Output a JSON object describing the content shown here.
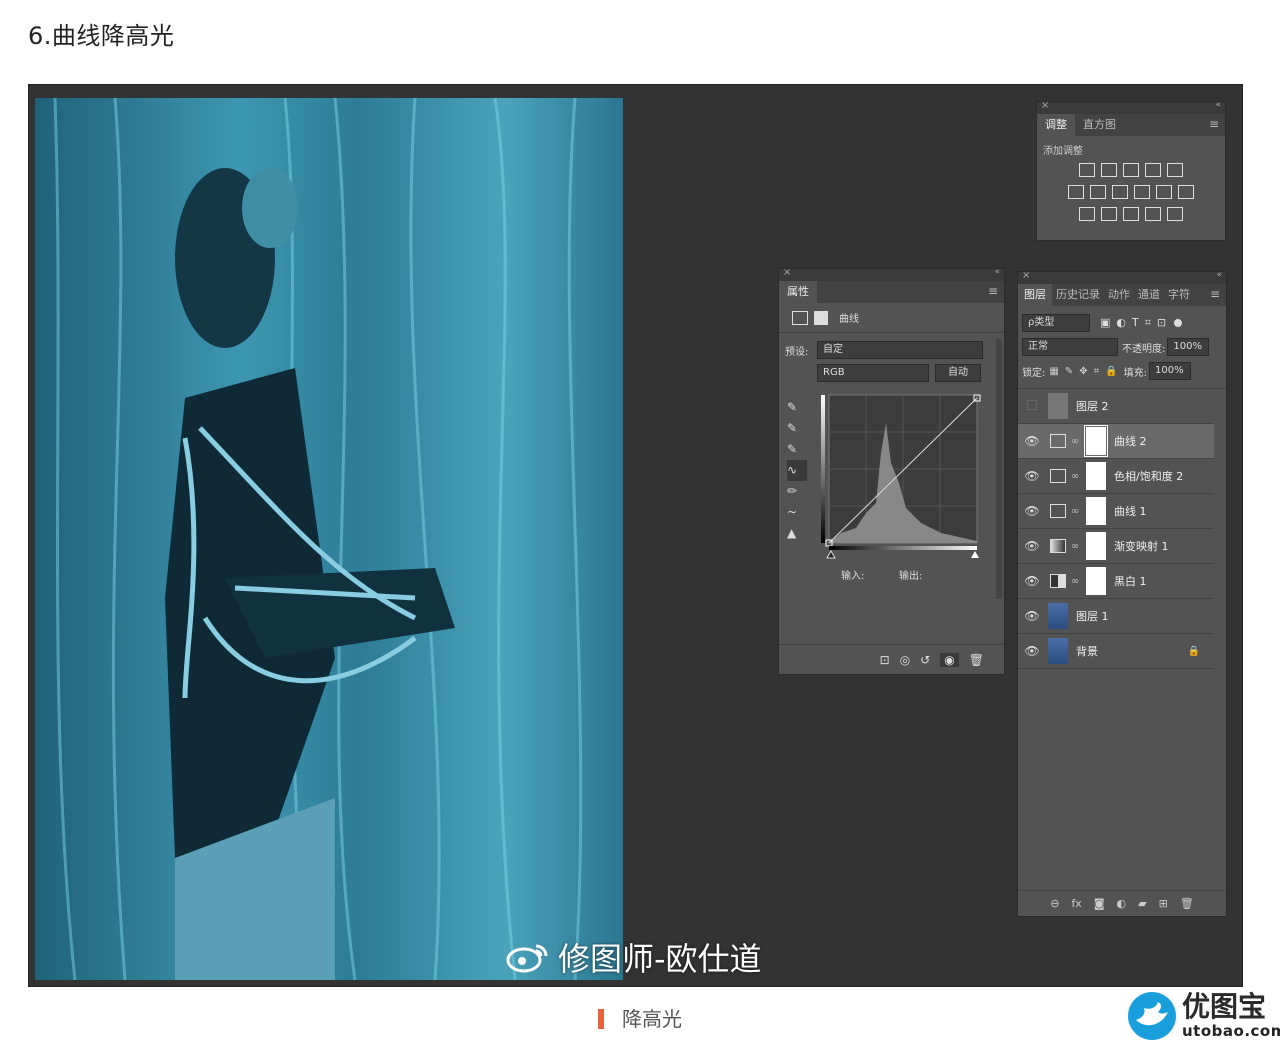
{
  "heading": "6.曲线降高光",
  "caption": "降高光",
  "watermark": "修图师-欧仕道",
  "brand": {
    "name": "优图宝",
    "domain": "utobao.com"
  },
  "adjustments": {
    "tabs": [
      "调整",
      "直方图"
    ],
    "add_label": "添加调整"
  },
  "properties": {
    "tab": "属性",
    "type_label": "曲线",
    "preset_label": "预设:",
    "preset_value": "自定",
    "channel": "RGB",
    "auto_button": "自动",
    "input_label": "输入:",
    "output_label": "输出:"
  },
  "layers_panel": {
    "tabs": [
      "图层",
      "历史记录",
      "动作",
      "通道",
      "字符"
    ],
    "filter": "ρ类型",
    "blend_mode": "正常",
    "opacity_label": "不透明度:",
    "opacity_value": "100%",
    "lock_label": "锁定:",
    "fill_label": "填充:",
    "fill_value": "100%",
    "layers": [
      {
        "name": "图层 2",
        "visible": false
      },
      {
        "name": "曲线 2",
        "visible": true
      },
      {
        "name": "色相/饱和度 2",
        "visible": true
      },
      {
        "name": "曲线 1",
        "visible": true
      },
      {
        "name": "渐变映射 1",
        "visible": true
      },
      {
        "name": "黑白 1",
        "visible": true
      },
      {
        "name": "图层 1",
        "visible": true
      },
      {
        "name": "背景",
        "visible": true
      }
    ]
  },
  "colors": {
    "accent": "#e8643f",
    "ps_panel": "#535353",
    "photo_tint": "#2f7d93"
  }
}
